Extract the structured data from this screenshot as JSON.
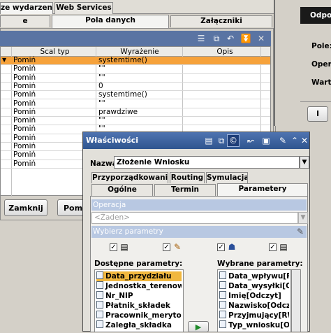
{
  "top_tabs": [
    {
      "label": "ze wydarzenia"
    },
    {
      "label": "Web Services"
    }
  ],
  "sub_tabs": [
    {
      "label": "e"
    },
    {
      "label": "Pola danych"
    },
    {
      "label": "Załączniki"
    }
  ],
  "columns": [
    "Scal typ",
    "Wyrażenie",
    "Opis"
  ],
  "rows": [
    {
      "typ": "Pomiń",
      "expr": "systemtime()"
    },
    {
      "typ": "Pomiń",
      "expr": "\"\""
    },
    {
      "typ": "Pomiń",
      "expr": "\"\""
    },
    {
      "typ": "Pomiń",
      "expr": "0"
    },
    {
      "typ": "Pomiń",
      "expr": "systemtime()"
    },
    {
      "typ": "Pomiń",
      "expr": "\"\""
    },
    {
      "typ": "Pomiń",
      "expr": "prawdziwe"
    },
    {
      "typ": "Pomiń",
      "expr": "\"\""
    },
    {
      "typ": "Pomiń",
      "expr": "\"\""
    },
    {
      "typ": "Pomiń",
      "expr": ""
    },
    {
      "typ": "Pomiń",
      "expr": ""
    },
    {
      "typ": "Pomiń",
      "expr": ""
    },
    {
      "typ": "Pomiń",
      "expr": ""
    }
  ],
  "buttons": {
    "zamknij": "Zamknij",
    "pomoc": "Pomo"
  },
  "right_panel": {
    "title": "Odpow",
    "pole": "Pole:",
    "opera": "Opera",
    "warto": "Warto",
    "btn": "I"
  },
  "dialog": {
    "title": "Właściwości",
    "name_label": "Nazwa",
    "name_value": "Złożenie Wniosku",
    "tabs_row1": [
      "Przyporządkowania",
      "Routing",
      "Symulacja"
    ],
    "tabs_row2": [
      "Ogólne",
      "Termin",
      "Parametery"
    ],
    "operation_label": "Operacja",
    "operation_placeholder": "<Żaden>",
    "select_params_label": "Wybierz parametry",
    "available_label": "Dostępne parametry:",
    "selected_label": "Wybrane parametry:",
    "available": [
      "Data_przydziału",
      "Jednostka_terenowa",
      "Nr_NIP",
      "Płatnik_składek",
      "Pracownik_merytoryczny",
      "Zaległa_składka"
    ],
    "selected": [
      "Data_wpływu[RW]",
      "Data_wysyłki[Odczyt]",
      "Imię[Odczyt]",
      "Nazwisko[Odczyt]",
      "Przyjmujący[RW]",
      "Typ_wniosku[Odczyt]"
    ]
  },
  "colors": {
    "highlight_row": "#f6a23b",
    "title_bar": "#3a5f9c",
    "selection": "#f1b73e"
  }
}
